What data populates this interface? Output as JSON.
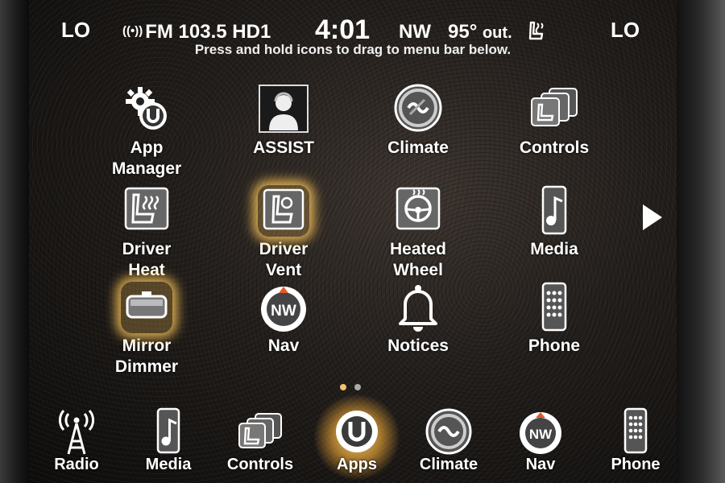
{
  "status_bar": {
    "left_temp": "LO",
    "right_temp": "LO",
    "radio": "FM 103.5 HD1",
    "clock": "4:01",
    "compass": "NW",
    "outside_temp": "95°",
    "outside_temp_unit": "out."
  },
  "hint": "Press and hold icons to drag to menu bar below.",
  "apps": [
    {
      "label1": "App",
      "label2": "Manager",
      "icon": "gear-u-icon"
    },
    {
      "label1": "ASSIST",
      "label2": "",
      "icon": "assist-person-icon"
    },
    {
      "label1": "Climate",
      "label2": "",
      "icon": "climate-icon"
    },
    {
      "label1": "Controls",
      "label2": "",
      "icon": "controls-icon"
    },
    {
      "label1": "Driver",
      "label2": "Heat",
      "icon": "heated-seat-icon"
    },
    {
      "label1": "Driver",
      "label2": "Vent",
      "icon": "vented-seat-icon",
      "highlighted": true
    },
    {
      "label1": "Heated",
      "label2": "Wheel",
      "icon": "heated-wheel-icon"
    },
    {
      "label1": "Media",
      "label2": "",
      "icon": "media-icon"
    },
    {
      "label1": "Mirror",
      "label2": "Dimmer",
      "icon": "mirror-icon",
      "highlighted": true
    },
    {
      "label1": "Nav",
      "label2": "",
      "icon": "nav-compass-icon"
    },
    {
      "label1": "Notices",
      "label2": "",
      "icon": "bell-icon"
    },
    {
      "label1": "Phone",
      "label2": "",
      "icon": "phone-icon"
    }
  ],
  "menu_bar": [
    {
      "label": "Radio",
      "icon": "radio-tower-icon"
    },
    {
      "label": "Media",
      "icon": "media-icon"
    },
    {
      "label": "Controls",
      "icon": "controls-icon"
    },
    {
      "label": "Apps",
      "icon": "apps-icon",
      "active": true
    },
    {
      "label": "Climate",
      "icon": "climate-icon"
    },
    {
      "label": "Nav",
      "icon": "nav-compass-icon"
    },
    {
      "label": "Phone",
      "icon": "phone-icon"
    }
  ],
  "pagination": {
    "pages": 2,
    "current": 1
  },
  "colors": {
    "highlight": "#ffc85a",
    "text": "#ffffff",
    "background": "#221e1b"
  }
}
